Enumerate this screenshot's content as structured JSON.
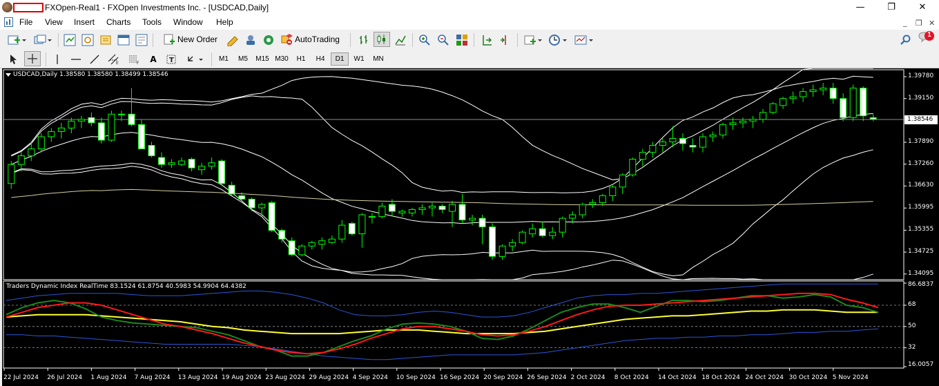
{
  "window": {
    "title": "FXOpen-Real1 - FXOpen Investments Inc. - [USDCAD,Daily]",
    "minimize_glyph": "—",
    "maximize_glyph": "❐",
    "close_glyph": "✕"
  },
  "menu": {
    "items": [
      "File",
      "View",
      "Insert",
      "Charts",
      "Tools",
      "Window",
      "Help"
    ],
    "mdi_minimize": "_",
    "mdi_restore": "❐",
    "mdi_close": "✕"
  },
  "toolbar": {
    "new_order": "New Order",
    "autotrading": "AutoTrading",
    "notification_count": "1"
  },
  "timeframes": [
    "M1",
    "M5",
    "M15",
    "M30",
    "H1",
    "H4",
    "D1",
    "W1",
    "MN"
  ],
  "active_timeframe": "D1",
  "colors": {
    "chart_bg": "#000000",
    "bull_candle": "#000000",
    "bear_candle": "#ffffff",
    "candle_outline": "#00ff00",
    "bands": "#ffffff",
    "tdi_rsi": "#1a8a1a",
    "tdi_signal": "#ff1a1a",
    "tdi_mbl": "#ffff33",
    "tdi_vb": "#2a58d8",
    "accent_red": "#e81123"
  },
  "chart_data": {
    "type": "candlestick",
    "symbol_info": "USDCAD,Daily  1.38580 1.38580 1.38499 1.38546",
    "current_price": "1.38546",
    "price_ticks": [
      "1.39780",
      "1.39150",
      "1.38546",
      "1.37890",
      "1.37260",
      "1.36630",
      "1.35995",
      "1.35355",
      "1.34725",
      "1.34095"
    ],
    "ylim": [
      1.3405,
      1.3986
    ],
    "candles": [
      [
        1.367,
        1.3735,
        1.3655,
        1.3725
      ],
      [
        1.3725,
        1.376,
        1.3705,
        1.375
      ],
      [
        1.375,
        1.379,
        1.3735,
        1.377
      ],
      [
        1.377,
        1.3815,
        1.376,
        1.3805
      ],
      [
        1.3805,
        1.383,
        1.379,
        1.382
      ],
      [
        1.382,
        1.3845,
        1.38,
        1.383
      ],
      [
        1.383,
        1.386,
        1.3815,
        1.385
      ],
      [
        1.385,
        1.3865,
        1.383,
        1.3855
      ],
      [
        1.386,
        1.3875,
        1.3835,
        1.3845
      ],
      [
        1.3845,
        1.386,
        1.3785,
        1.3795
      ],
      [
        1.3795,
        1.388,
        1.379,
        1.387
      ],
      [
        1.387,
        1.388,
        1.385,
        1.387
      ],
      [
        1.387,
        1.3945,
        1.3835,
        1.384
      ],
      [
        1.384,
        1.3855,
        1.377,
        1.377
      ],
      [
        1.378,
        1.379,
        1.3745,
        1.375
      ],
      [
        1.3745,
        1.376,
        1.3715,
        1.3725
      ],
      [
        1.3725,
        1.374,
        1.3715,
        1.373
      ],
      [
        1.3725,
        1.3745,
        1.372,
        1.3735
      ],
      [
        1.374,
        1.3745,
        1.3705,
        1.3715
      ],
      [
        1.371,
        1.373,
        1.3695,
        1.372
      ],
      [
        1.372,
        1.3745,
        1.371,
        1.373
      ],
      [
        1.3735,
        1.374,
        1.3665,
        1.367
      ],
      [
        1.3665,
        1.3675,
        1.3635,
        1.364
      ],
      [
        1.3635,
        1.3645,
        1.362,
        1.3625
      ],
      [
        1.3625,
        1.363,
        1.359,
        1.36
      ],
      [
        1.36,
        1.3615,
        1.3575,
        1.361
      ],
      [
        1.3615,
        1.362,
        1.353,
        1.3535
      ],
      [
        1.3535,
        1.354,
        1.35,
        1.351
      ],
      [
        1.3505,
        1.3515,
        1.346,
        1.3465
      ],
      [
        1.3465,
        1.3495,
        1.346,
        1.349
      ],
      [
        1.349,
        1.3505,
        1.348,
        1.35
      ],
      [
        1.3495,
        1.3515,
        1.348,
        1.3505
      ],
      [
        1.35,
        1.352,
        1.3495,
        1.351
      ],
      [
        1.351,
        1.3565,
        1.35,
        1.355
      ],
      [
        1.3555,
        1.356,
        1.352,
        1.3525
      ],
      [
        1.3525,
        1.3585,
        1.3485,
        1.358
      ],
      [
        1.3575,
        1.3585,
        1.3555,
        1.3575
      ],
      [
        1.3575,
        1.3615,
        1.357,
        1.3605
      ],
      [
        1.361,
        1.3625,
        1.3575,
        1.359
      ],
      [
        1.3585,
        1.3595,
        1.3575,
        1.359
      ],
      [
        1.3585,
        1.36,
        1.3575,
        1.3595
      ],
      [
        1.3595,
        1.361,
        1.358,
        1.36
      ],
      [
        1.36,
        1.3615,
        1.3575,
        1.3605
      ],
      [
        1.3605,
        1.361,
        1.3585,
        1.3595
      ],
      [
        1.359,
        1.362,
        1.3545,
        1.361
      ],
      [
        1.361,
        1.364,
        1.3555,
        1.3565
      ],
      [
        1.3565,
        1.358,
        1.355,
        1.357
      ],
      [
        1.357,
        1.358,
        1.3495,
        1.3545
      ],
      [
        1.3545,
        1.3555,
        1.345,
        1.346
      ],
      [
        1.346,
        1.3495,
        1.345,
        1.349
      ],
      [
        1.349,
        1.351,
        1.3475,
        1.35
      ],
      [
        1.35,
        1.3535,
        1.3495,
        1.353
      ],
      [
        1.3525,
        1.3555,
        1.3515,
        1.354
      ],
      [
        1.354,
        1.356,
        1.3515,
        1.352
      ],
      [
        1.352,
        1.3545,
        1.351,
        1.353
      ],
      [
        1.353,
        1.3575,
        1.3515,
        1.357
      ],
      [
        1.357,
        1.359,
        1.3555,
        1.358
      ],
      [
        1.358,
        1.3615,
        1.357,
        1.361
      ],
      [
        1.361,
        1.3625,
        1.36,
        1.3615
      ],
      [
        1.3615,
        1.364,
        1.3605,
        1.3635
      ],
      [
        1.3635,
        1.3665,
        1.362,
        1.366
      ],
      [
        1.366,
        1.37,
        1.364,
        1.3695
      ],
      [
        1.3695,
        1.3745,
        1.369,
        1.374
      ],
      [
        1.374,
        1.377,
        1.372,
        1.376
      ],
      [
        1.376,
        1.379,
        1.3745,
        1.378
      ],
      [
        1.378,
        1.38,
        1.376,
        1.379
      ],
      [
        1.379,
        1.3835,
        1.3775,
        1.38
      ],
      [
        1.38,
        1.3815,
        1.3765,
        1.3785
      ],
      [
        1.378,
        1.38,
        1.376,
        1.3775
      ],
      [
        1.3775,
        1.3815,
        1.376,
        1.3805
      ],
      [
        1.3805,
        1.382,
        1.379,
        1.381
      ],
      [
        1.381,
        1.3845,
        1.38,
        1.384
      ],
      [
        1.384,
        1.386,
        1.3825,
        1.3845
      ],
      [
        1.3845,
        1.386,
        1.383,
        1.385
      ],
      [
        1.385,
        1.3865,
        1.383,
        1.3855
      ],
      [
        1.3855,
        1.3885,
        1.3845,
        1.3875
      ],
      [
        1.3875,
        1.3905,
        1.387,
        1.39
      ],
      [
        1.3895,
        1.392,
        1.3885,
        1.3915
      ],
      [
        1.3915,
        1.3935,
        1.39,
        1.392
      ],
      [
        1.392,
        1.3945,
        1.3905,
        1.3935
      ],
      [
        1.3935,
        1.3955,
        1.392,
        1.394
      ],
      [
        1.394,
        1.396,
        1.3925,
        1.3945
      ],
      [
        1.3945,
        1.396,
        1.39,
        1.3915
      ],
      [
        1.3915,
        1.393,
        1.385,
        1.386
      ],
      [
        1.386,
        1.3955,
        1.385,
        1.3945
      ],
      [
        1.3945,
        1.395,
        1.385,
        1.3865
      ],
      [
        1.386,
        1.387,
        1.385,
        1.3855
      ]
    ],
    "date_labels": [
      "22 Jul 2024",
      "26 Jul 2024",
      "1 Aug 2024",
      "7 Aug 2024",
      "13 Aug 2024",
      "19 Aug 2024",
      "23 Aug 2024",
      "29 Aug 2024",
      "4 Sep 2024",
      "10 Sep 2024",
      "16 Sep 2024",
      "20 Sep 2024",
      "26 Sep 2024",
      "2 Oct 2024",
      "8 Oct 2024",
      "14 Oct 2024",
      "18 Oct 2024",
      "24 Oct 2024",
      "30 Oct 2024",
      "5 Nov 2024"
    ],
    "tdi": {
      "info": "Traders Dynamic Index RealTime 83.1524 61.8754 40.5983 54.9904 64.4382",
      "ticks": [
        "86.6837",
        "68",
        "50",
        "32",
        "16.0057"
      ],
      "ylim": [
        16.0057,
        86.6837
      ],
      "levels": [
        68,
        50,
        32
      ],
      "rsi": [
        60,
        66,
        70,
        72,
        70,
        65,
        58,
        55,
        53,
        52,
        51,
        50,
        49,
        46,
        43,
        38,
        33,
        30,
        25,
        25,
        28,
        33,
        38,
        42,
        48,
        52,
        53,
        52,
        50,
        46,
        40,
        39,
        42,
        48,
        55,
        62,
        66,
        69,
        69,
        66,
        62,
        67,
        72,
        72,
        71,
        72,
        74,
        76,
        76,
        74,
        75,
        77,
        75,
        68,
        66,
        62
      ],
      "signal": [
        58,
        62,
        66,
        68,
        70,
        70,
        68,
        64,
        60,
        56,
        52,
        50,
        47,
        44,
        40,
        36,
        33,
        30,
        28,
        27,
        28,
        31,
        35,
        40,
        44,
        48,
        50,
        50,
        48,
        46,
        43,
        42,
        43,
        46,
        50,
        55,
        60,
        64,
        67,
        68,
        68,
        69,
        70,
        71,
        72,
        73,
        74,
        75,
        76,
        77,
        78,
        78,
        77,
        73,
        70,
        66
      ],
      "mbl": [
        58,
        59,
        60,
        60,
        60,
        60,
        59,
        58,
        57,
        56,
        55,
        54,
        52,
        50,
        49,
        47,
        46,
        45,
        44,
        44,
        44,
        44,
        45,
        46,
        47,
        47,
        47,
        46,
        45,
        44,
        44,
        44,
        44,
        45,
        46,
        48,
        50,
        52,
        54,
        56,
        57,
        58,
        59,
        59,
        60,
        61,
        62,
        63,
        63,
        64,
        64,
        64,
        63,
        62,
        62,
        62
      ],
      "vb_upper": [
        72,
        74,
        76,
        77,
        78,
        78,
        78,
        78,
        77,
        76,
        76,
        76,
        77,
        78,
        79,
        80,
        80,
        79,
        77,
        74,
        70,
        64,
        60,
        59,
        59,
        60,
        62,
        63,
        62,
        60,
        58,
        58,
        59,
        62,
        66,
        70,
        74,
        76,
        77,
        77,
        78,
        78,
        79,
        80,
        81,
        82,
        83,
        84,
        85,
        86,
        86,
        86,
        86,
        86,
        86,
        86
      ],
      "vb_lower": [
        43,
        43,
        42,
        42,
        41,
        40,
        39,
        38,
        37,
        36,
        35,
        35,
        35,
        35,
        35,
        34,
        33,
        31,
        29,
        27,
        25,
        24,
        23,
        22,
        22,
        23,
        24,
        25,
        26,
        26,
        26,
        26,
        26,
        27,
        28,
        30,
        32,
        34,
        36,
        38,
        39,
        40,
        40,
        41,
        41,
        42,
        42,
        43,
        43,
        44,
        45,
        45,
        46,
        46,
        47,
        48
      ]
    }
  }
}
